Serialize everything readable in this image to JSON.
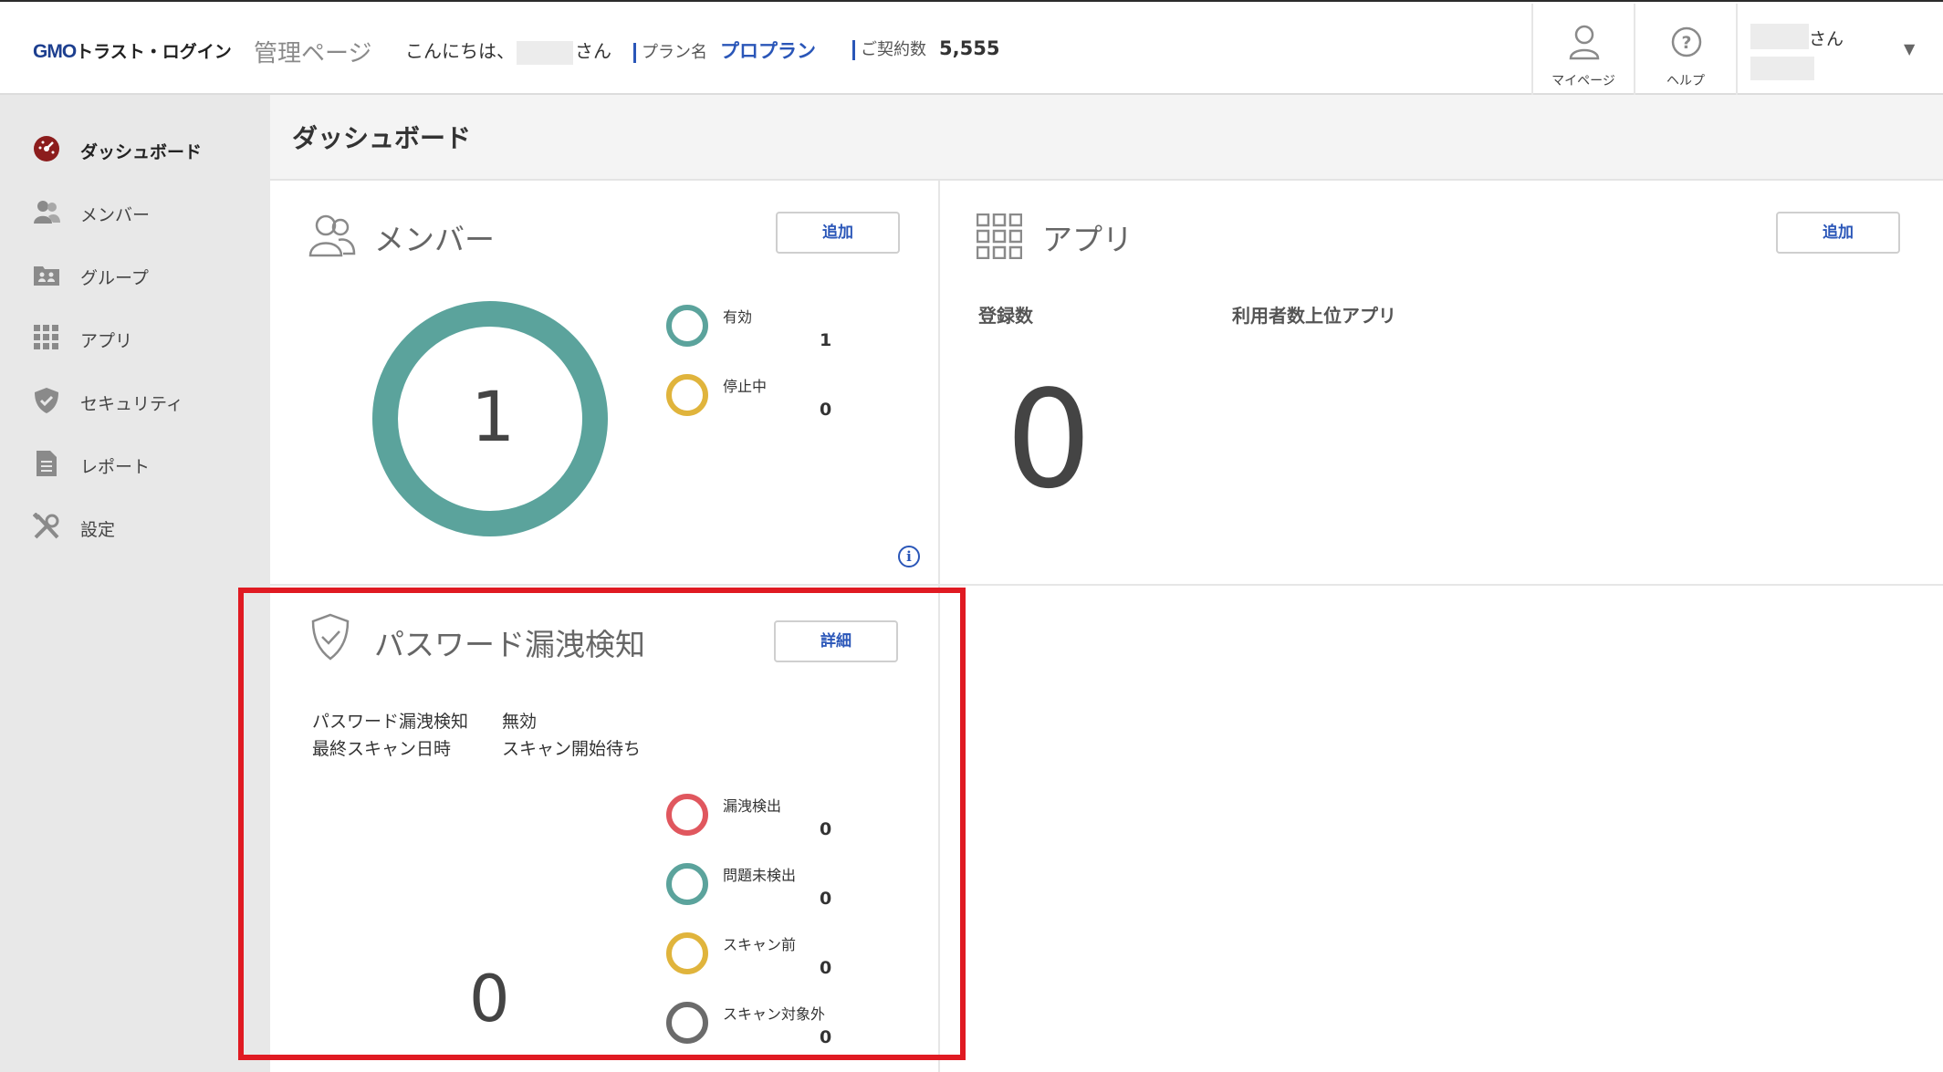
{
  "header": {
    "logo_gmo": "GMO",
    "logo_rest": "トラスト・ログイン",
    "admin_page": "管理ページ",
    "greeting": "こんにちは、",
    "greeting_suffix": "さん",
    "plan_label": "プラン名",
    "plan_value": "プロプラン",
    "contract_label": "ご契約数",
    "contract_value": "5,555",
    "mypage_label": "マイページ",
    "help_label": "ヘルプ",
    "user_suffix": "さん",
    "user_caret": "▼"
  },
  "sidebar": {
    "items": [
      {
        "label": "ダッシュボード",
        "icon": "dashboard-icon",
        "active": true
      },
      {
        "label": "メンバー",
        "icon": "members-icon",
        "active": false
      },
      {
        "label": "グループ",
        "icon": "group-icon",
        "active": false
      },
      {
        "label": "アプリ",
        "icon": "apps-grid-icon",
        "active": false
      },
      {
        "label": "セキュリティ",
        "icon": "shield-icon",
        "active": false
      },
      {
        "label": "レポート",
        "icon": "report-icon",
        "active": false
      },
      {
        "label": "設定",
        "icon": "tools-icon",
        "active": false
      }
    ]
  },
  "main": {
    "page_title": "ダッシュボード",
    "members_card": {
      "title": "メンバー",
      "add_button": "追加",
      "total": "1",
      "legend": [
        {
          "label": "有効",
          "value": "1",
          "color": "#5ba39c"
        },
        {
          "label": "停止中",
          "value": "0",
          "color": "#e0b43c"
        }
      ],
      "info_icon": "i"
    },
    "apps_card": {
      "title": "アプリ",
      "add_button": "追加",
      "registered_label": "登録数",
      "top_apps_label": "利用者数上位アプリ",
      "registered_value": "0"
    },
    "password_card": {
      "title": "パスワード漏洩検知",
      "detail_button": "詳細",
      "status_label": "パスワード漏洩検知",
      "status_value": "無効",
      "last_scan_label": "最終スキャン日時",
      "last_scan_value": "スキャン開始待ち",
      "total": "0",
      "legend": [
        {
          "label": "漏洩検出",
          "value": "0",
          "color": "#e0575e"
        },
        {
          "label": "問題未検出",
          "value": "0",
          "color": "#5ba39c"
        },
        {
          "label": "スキャン前",
          "value": "0",
          "color": "#e0b43c"
        },
        {
          "label": "スキャン対象外",
          "value": "0",
          "color": "#6b6b6b"
        }
      ]
    }
  },
  "colors": {
    "accent_blue": "#2a56b8",
    "highlight_red": "#e01a22",
    "ring_teal": "#5ba39c"
  }
}
